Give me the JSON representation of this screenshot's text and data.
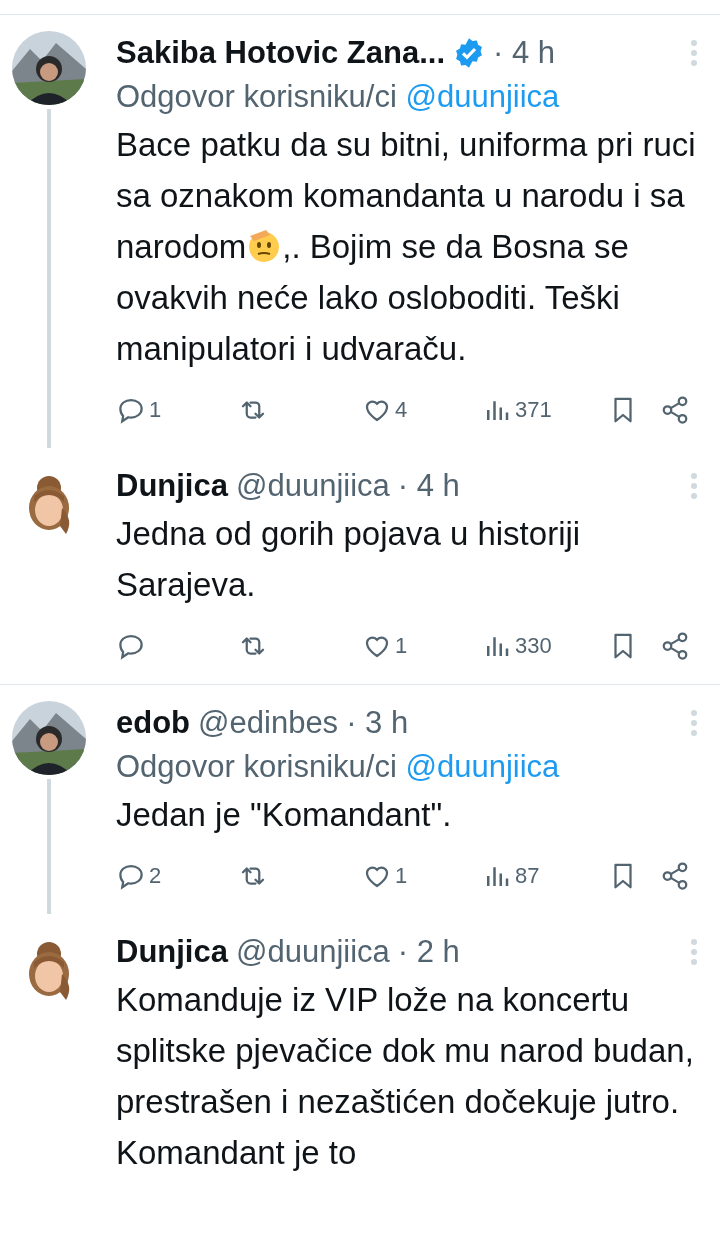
{
  "tweets": [
    {
      "name": "Sakiba Hotovic Zana...",
      "verified": true,
      "time": "· 4 h",
      "reply_to_label": "Odgovor korisniku/ci",
      "reply_to": "@duunjiica",
      "body": "Bace patku da su bitni, uniforma pri ruci sa oznakom komandanta u narodu i sa narodom",
      "body_emoji": {
        "kind": "saluting"
      },
      "body_after": ",. Bojim se da Bosna se ovakvih neće lako osloboditi. Teški manipulatori i udvaraču.",
      "reply_count": "1",
      "like_count": "4",
      "views": "371",
      "thread_continues": true,
      "divider_after": false
    },
    {
      "avatar": {
        "kind": "cartoon"
      },
      "name": "Dunjica",
      "verified": false,
      "handle": "@duunjiica",
      "time": "· 4 h",
      "body": "Jedna od gorih pojava u historiji Sarajeva.",
      "like_count": "1",
      "views": "330",
      "thread_continues": false,
      "divider_after": true
    },
    {
      "name": "edob",
      "verified": false,
      "handle": "@edinbes",
      "time": "· 3 h",
      "reply_to_label": "Odgovor korisniku/ci",
      "reply_to": "@duunjiica",
      "body": "Jedan je \"Komandant\".",
      "reply_count": "2",
      "like_count": "1",
      "views": "87",
      "thread_continues": true,
      "divider_after": false
    },
    {
      "avatar": {
        "kind": "cartoon"
      },
      "name": "Dunjica",
      "verified": false,
      "handle": "@duunjiica",
      "time": "· 2 h",
      "body": "Komanduje iz VIP lože na koncertu splitske pjevačice dok mu narod budan, prestrašen i nezaštićen dočekuje jutro. Komandant je to",
      "thread_continues": false,
      "divider_after": false
    }
  ]
}
